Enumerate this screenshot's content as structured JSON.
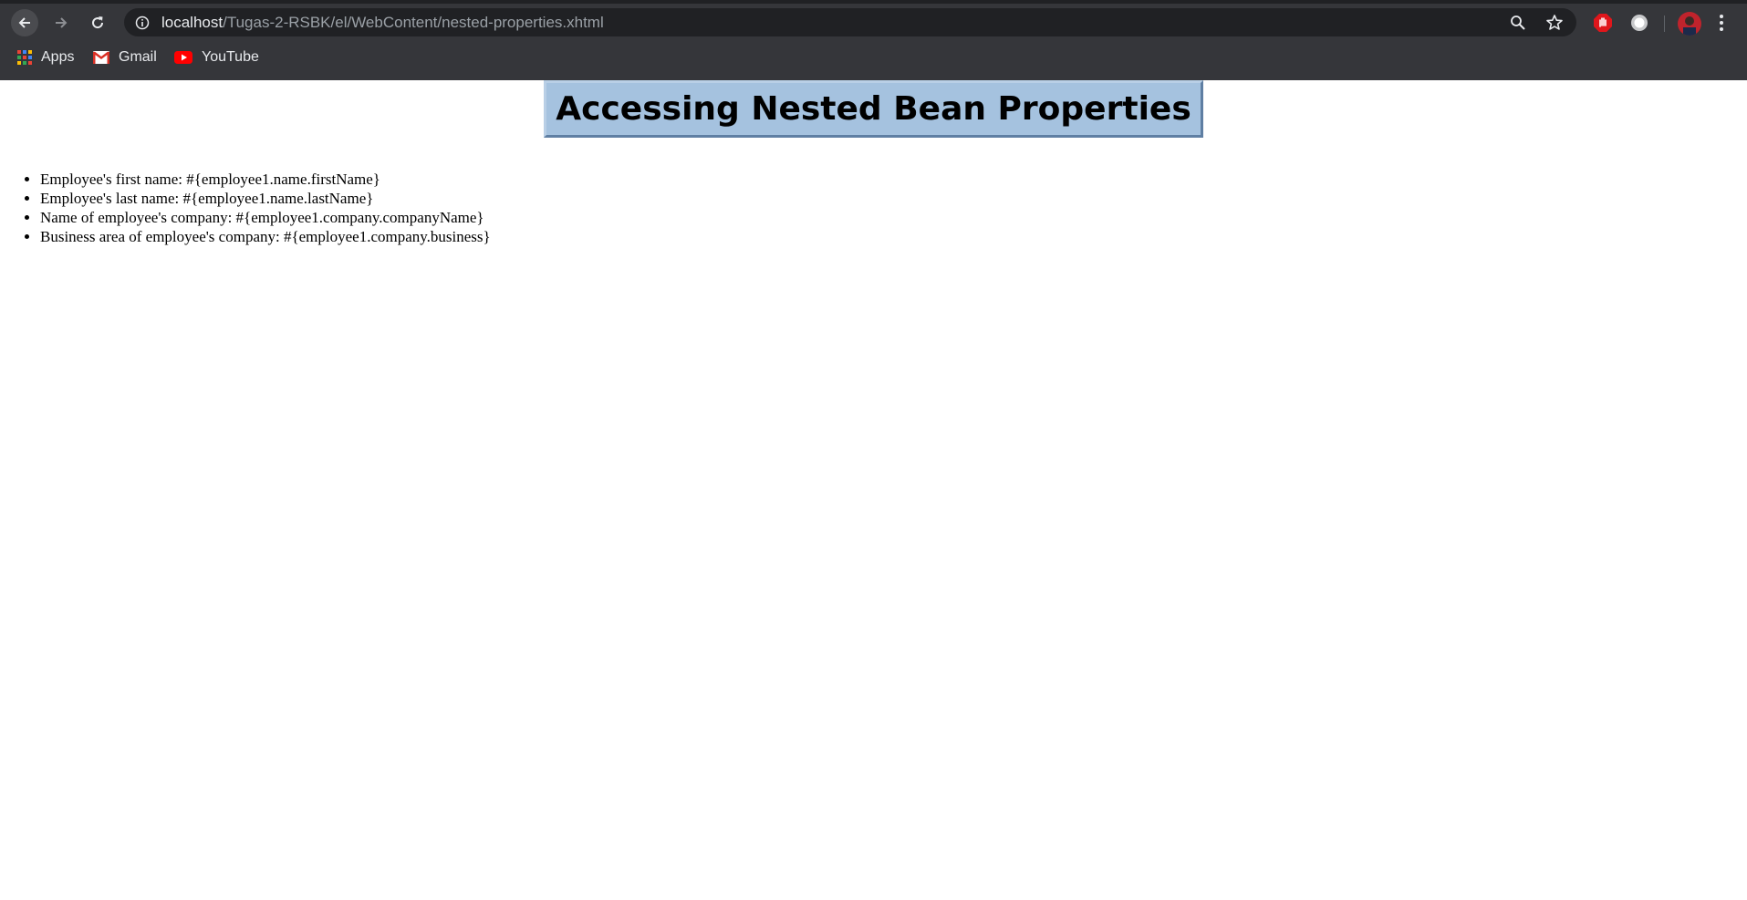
{
  "browser": {
    "url_host": "localhost",
    "url_path": "/Tugas-2-RSBK/el/WebContent/nested-properties.xhtml",
    "bookmarks": [
      "Apps",
      "Gmail",
      "YouTube"
    ]
  },
  "page": {
    "title": "Accessing Nested Bean Properties",
    "items": [
      "Employee's first name: #{employee1.name.firstName}",
      "Employee's last name: #{employee1.name.lastName}",
      "Name of employee's company: #{employee1.company.companyName}",
      "Business area of employee's company: #{employee1.company.business}"
    ]
  },
  "colors": {
    "chrome_bg": "#35363a",
    "omnibox_bg": "#202124",
    "title_bg": "#a5c2df"
  },
  "icons": [
    "back-arrow-icon",
    "forward-arrow-icon",
    "reload-icon",
    "info-icon",
    "zoom-icon",
    "star-icon",
    "adblock-icon",
    "extension-icon",
    "avatar",
    "menu-dots-icon",
    "apps-grid-icon",
    "gmail-icon",
    "youtube-icon"
  ]
}
